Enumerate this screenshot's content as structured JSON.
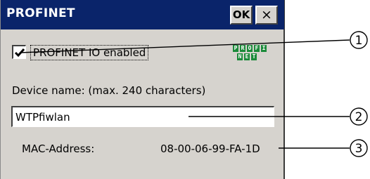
{
  "window": {
    "title": "PROFINET",
    "ok_label": "OK",
    "close_label": "×"
  },
  "profinet_io": {
    "label": "PROFINET IO enabled",
    "checked": true
  },
  "logo": {
    "row1": [
      "P",
      "R",
      "O",
      "F",
      "I"
    ],
    "row2": [
      "N",
      "E",
      "T"
    ]
  },
  "device_name": {
    "label": "Device name: (max. 240 characters)",
    "value": "WTPfiwlan"
  },
  "mac": {
    "label": "MAC-Address:",
    "value": "08-00-06-99-FA-1D"
  },
  "callouts": {
    "one": "1",
    "two": "2",
    "three": "3"
  }
}
